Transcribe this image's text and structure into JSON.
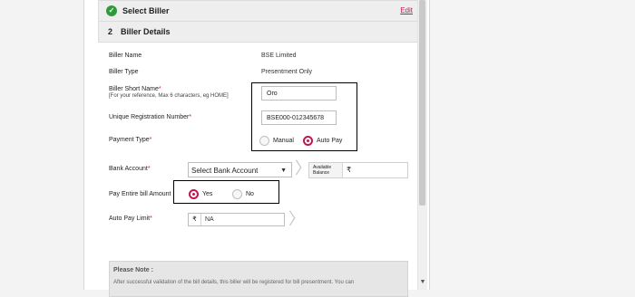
{
  "sections": {
    "select_biller": {
      "title": "Select Biller",
      "edit_label": "Edit"
    },
    "biller_details": {
      "step": "2",
      "title": "Biller Details"
    }
  },
  "fields": {
    "biller_name": {
      "label": "Biller Name",
      "value": "BSE Limited"
    },
    "biller_type": {
      "label": "Biller Type",
      "value": "Presentment Only"
    },
    "short_name": {
      "label": "Biller Short Name",
      "hint": "[For your reference, Max 6 characters, eg HOME]",
      "value": "Oro"
    },
    "registration": {
      "label": "Unique Registration Number",
      "value": "BSE000-012345678"
    },
    "payment_type": {
      "label": "Payment Type",
      "options": [
        "Manual",
        "Auto Pay"
      ],
      "selected": "Auto Pay"
    },
    "bank_account": {
      "label": "Bank Account",
      "value": "Select Bank Account"
    },
    "available_balance": {
      "label_line1": "Available",
      "label_line2": "Balance",
      "currency": "₹"
    },
    "pay_entire": {
      "label": "Pay Entire bill Amount",
      "options": [
        "Yes",
        "No"
      ],
      "selected": "Yes"
    },
    "auto_pay_limit": {
      "label": "Auto Pay Limit",
      "currency": "₹",
      "value": "NA"
    }
  },
  "required_mark": "*",
  "note": {
    "title": "Please Note :",
    "body": "After successful validation of the bill details, this biller will be registered for bill presentment. You can"
  },
  "colors": {
    "accent": "#c0174f",
    "check": "#2e9a3a"
  }
}
